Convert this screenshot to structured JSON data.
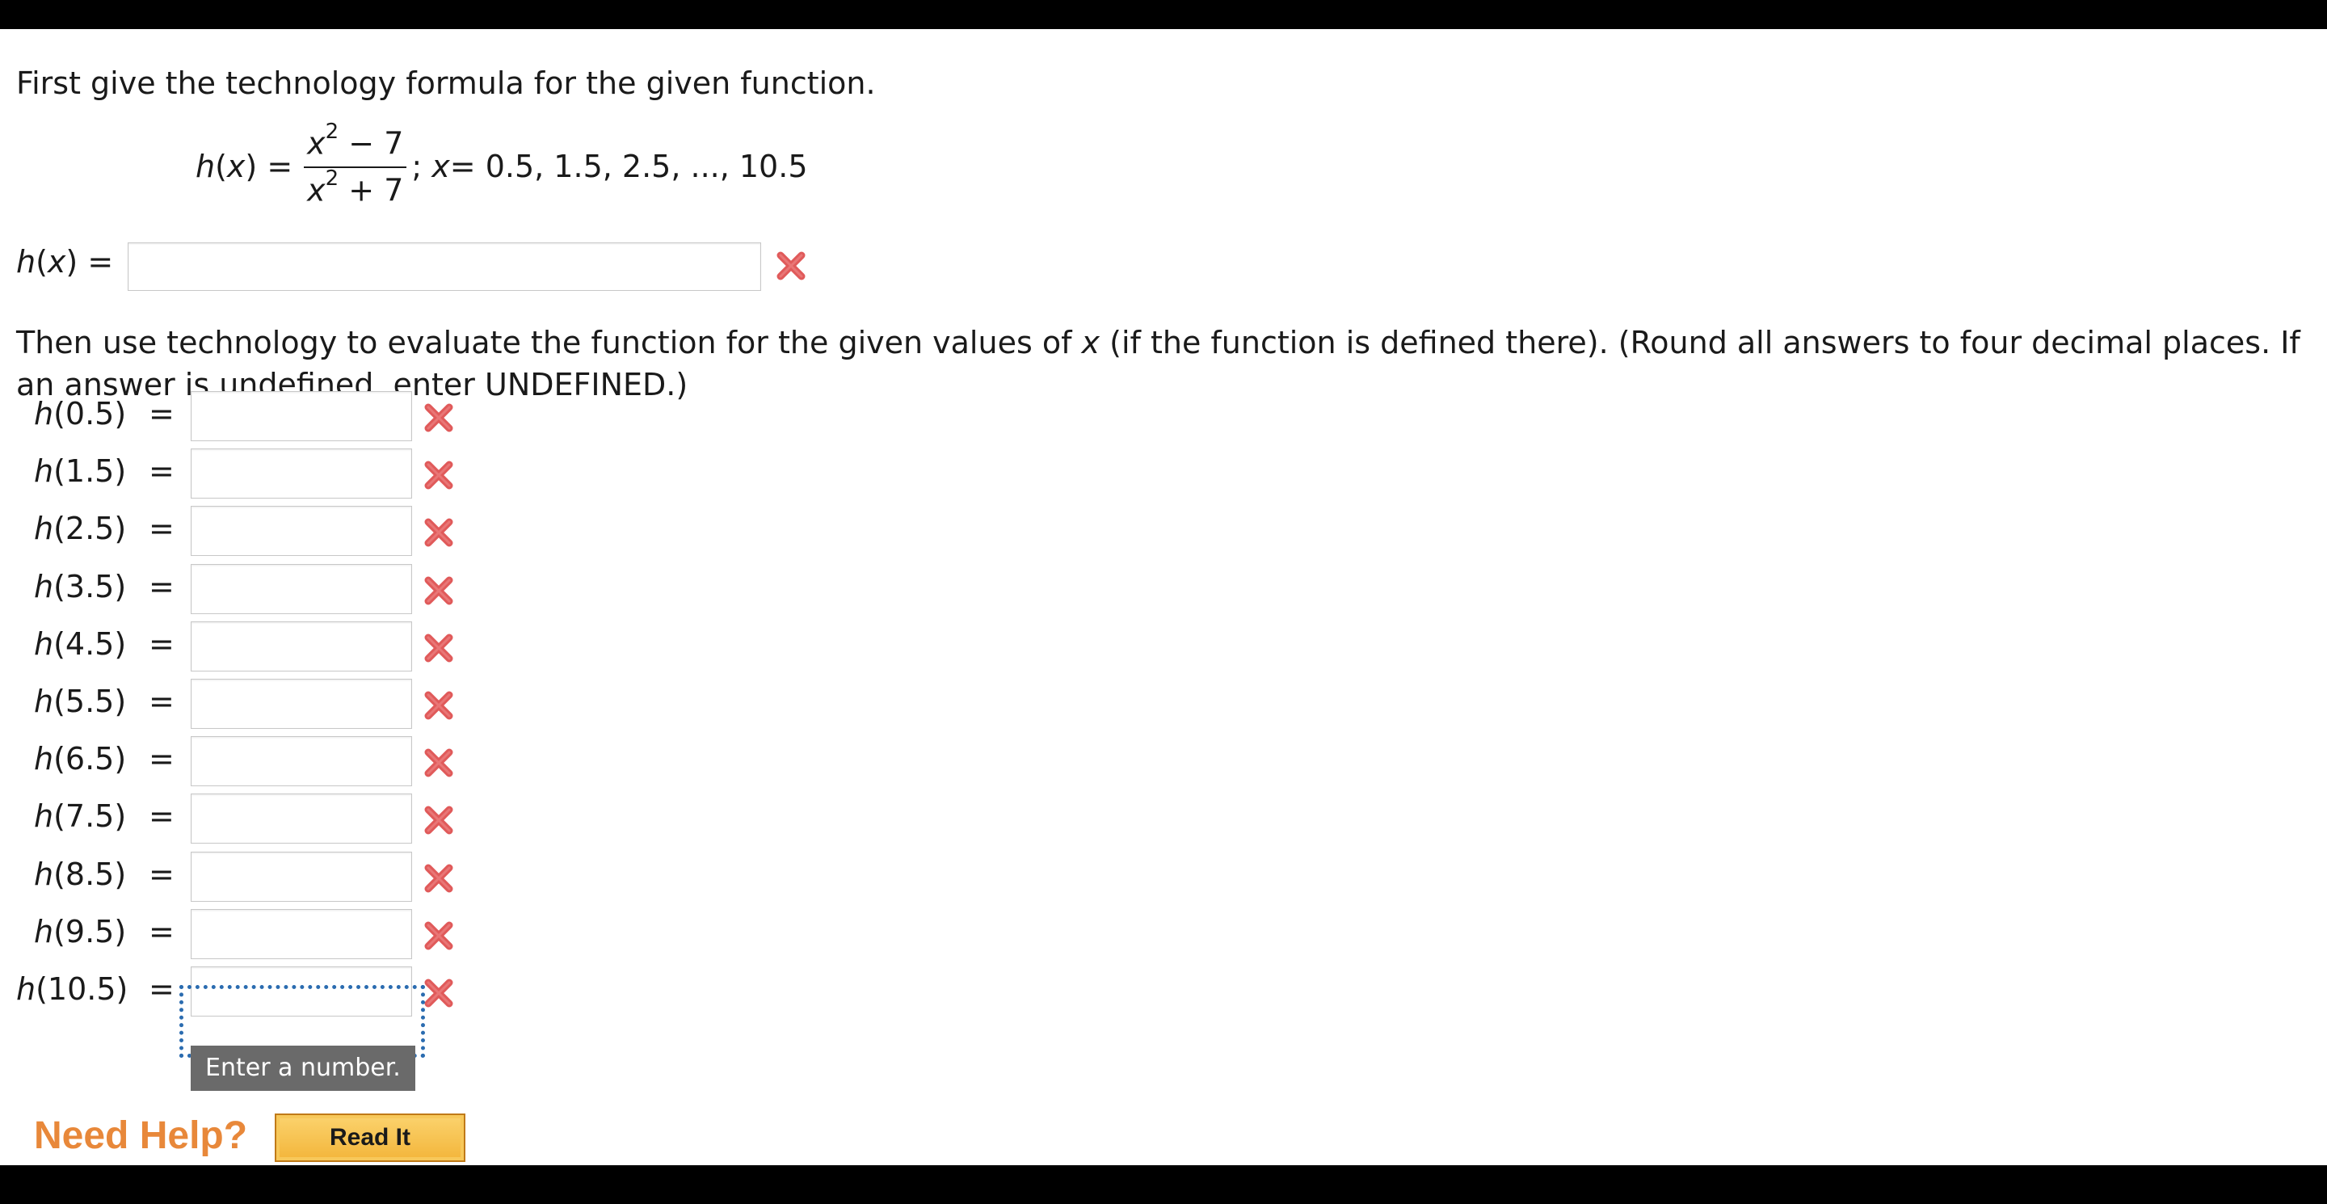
{
  "intro": "First give the technology formula for the given function.",
  "formula": {
    "lhs_fn": "h",
    "lhs_var": "x",
    "eq": "=",
    "num_base": "x",
    "num_exp": "2",
    "num_rest": " − 7",
    "den_base": "x",
    "den_exp": "2",
    "den_rest": " + 7",
    "domain_var": "x",
    "domain_rest": " = 0.5, 1.5, 2.5, ..., 10.5"
  },
  "answer_formula": {
    "label_fn": "h",
    "label_var": "x",
    "label_eq": "=",
    "value": ""
  },
  "instructions": {
    "part1": "Then use technology to evaluate the function for the given values of ",
    "var": "x",
    "part2": " (if the function is defined there). (Round all answers to four decimal places. If an answer is undefined, enter UNDEFINED.)"
  },
  "rows": [
    {
      "fn": "h",
      "arg": "(0.5)",
      "value": ""
    },
    {
      "fn": "h",
      "arg": "(1.5)",
      "value": ""
    },
    {
      "fn": "h",
      "arg": "(2.5)",
      "value": ""
    },
    {
      "fn": "h",
      "arg": "(3.5)",
      "value": ""
    },
    {
      "fn": "h",
      "arg": "(4.5)",
      "value": ""
    },
    {
      "fn": "h",
      "arg": "(5.5)",
      "value": ""
    },
    {
      "fn": "h",
      "arg": "(6.5)",
      "value": ""
    },
    {
      "fn": "h",
      "arg": "(7.5)",
      "value": ""
    },
    {
      "fn": "h",
      "arg": "(8.5)",
      "value": ""
    },
    {
      "fn": "h",
      "arg": "(9.5)",
      "value": ""
    },
    {
      "fn": "h",
      "arg": "(10.5)",
      "value": ""
    }
  ],
  "eq_sign": "=",
  "tooltip": "Enter a number.",
  "help": {
    "label": "Need Help?",
    "button": "Read It",
    "color": "#e8883a"
  },
  "status_icon": "incorrect-x-icon",
  "status_color": "#e05a5a",
  "focus_color": "#2b6cb0"
}
